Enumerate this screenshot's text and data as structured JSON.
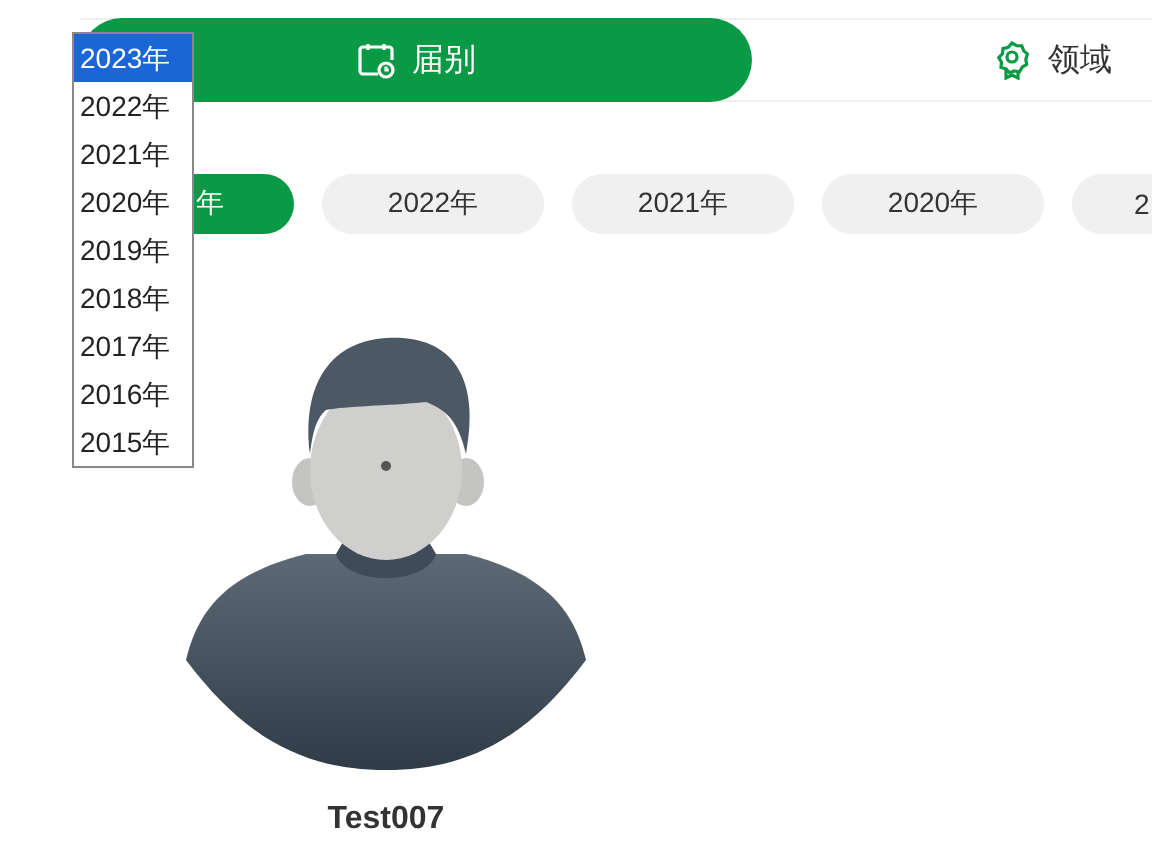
{
  "tabs": [
    {
      "kind": "calendar",
      "label": "届别",
      "selected": true
    },
    {
      "kind": "badge",
      "label": "领域",
      "selected": false
    }
  ],
  "years": [
    {
      "label": "年",
      "selected": true
    },
    {
      "label": "2022年",
      "selected": false
    },
    {
      "label": "2021年",
      "selected": false
    },
    {
      "label": "2020年",
      "selected": false
    },
    {
      "label": "2",
      "selected": false
    }
  ],
  "dropdown": {
    "options": [
      {
        "label": "2023年",
        "selected": true
      },
      {
        "label": "2022年",
        "selected": false
      },
      {
        "label": "2021年",
        "selected": false
      },
      {
        "label": "2020年",
        "selected": false
      },
      {
        "label": "2019年",
        "selected": false
      },
      {
        "label": "2018年",
        "selected": false
      },
      {
        "label": "2017年",
        "selected": false
      },
      {
        "label": "2016年",
        "selected": false
      },
      {
        "label": "2015年",
        "selected": false
      }
    ]
  },
  "profile": {
    "name": "Test007"
  }
}
